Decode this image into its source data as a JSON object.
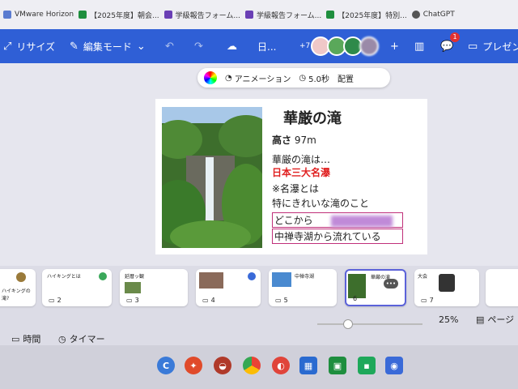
{
  "bookmarks": [
    {
      "label": "VMware Horizon",
      "icon": "vmware-icon",
      "color": "#5a7bd0"
    },
    {
      "label": "【2025年度】朝会...",
      "icon": "sheets-icon",
      "color": "#1e8e3e"
    },
    {
      "label": "学級報告フォーム...",
      "icon": "forms-icon",
      "color": "#6a3fb5"
    },
    {
      "label": "学級報告フォーム...",
      "icon": "forms-icon",
      "color": "#6a3fb5"
    },
    {
      "label": "【2025年度】特別...",
      "icon": "sheets-icon",
      "color": "#1e8e3e"
    },
    {
      "label": "ChatGPT",
      "icon": "chatgpt-icon",
      "color": "#555555"
    }
  ],
  "toolbar": {
    "resize_label": "リサイズ",
    "edit_mode_label": "編集モード",
    "date_label": "日...",
    "collab_count": "+7",
    "notification_count": "1",
    "present_label": "プレゼン"
  },
  "anim_bar": {
    "animation_label": "アニメーション",
    "duration_label": "5.0秒",
    "layout_label": "配置"
  },
  "slide": {
    "title": "華厳の滝",
    "height_label": "高さ",
    "height_value": "97m",
    "line1": "華厳の滝は…",
    "line2": "日本三大名瀑",
    "line3": "※名瀑とは",
    "line4": "特にきれいな滝のこと",
    "line5": "どこから",
    "line6": "中禅寺湖から流れている"
  },
  "thumbnails": [
    {
      "num": "",
      "title": "ハイキングの滝?"
    },
    {
      "num": "2",
      "title": "ハイキングとは"
    },
    {
      "num": "3",
      "title": "延暦ッ観"
    },
    {
      "num": "4",
      "title": ""
    },
    {
      "num": "5",
      "title": "中禅寺湖"
    },
    {
      "num": "6",
      "title": "華厳の滝"
    },
    {
      "num": "7",
      "title": "大会"
    },
    {
      "num": "",
      "title": ""
    }
  ],
  "bottom": {
    "time_label": "時間",
    "timer_label": "タイマー",
    "zoom_label": "25%",
    "page_label": "ページ"
  },
  "colors": {
    "toolbar": "#2f5fd6",
    "accent": "#5b62d9",
    "title_red": "#e02020"
  }
}
